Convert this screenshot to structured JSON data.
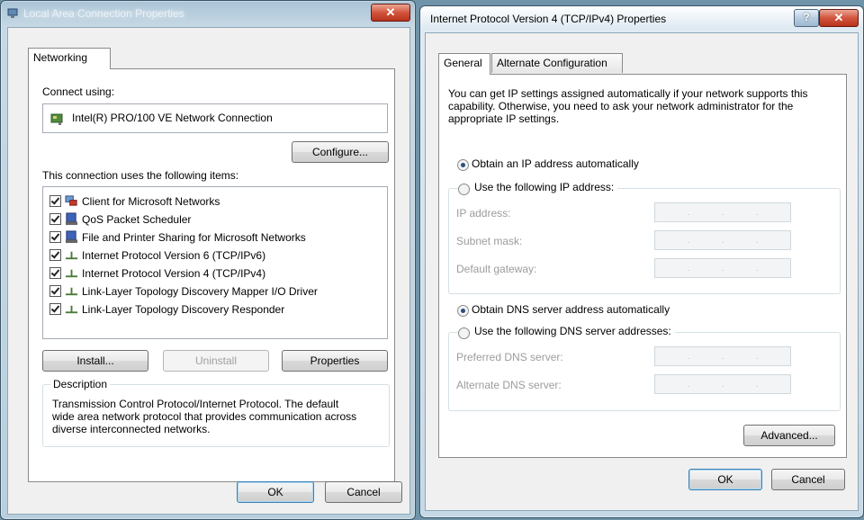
{
  "left_window": {
    "title": "Local Area Connection Properties",
    "tab": "Networking",
    "connect_using_label": "Connect using:",
    "adapter": "Intel(R) PRO/100 VE Network Connection",
    "configure_button": "Configure...",
    "items_label": "This connection uses the following items:",
    "items": [
      {
        "label": "Client for Microsoft Networks",
        "checked": true,
        "icon": "network-client-icon"
      },
      {
        "label": "QoS Packet Scheduler",
        "checked": true,
        "icon": "service-icon"
      },
      {
        "label": "File and Printer Sharing for Microsoft Networks",
        "checked": true,
        "icon": "service-icon"
      },
      {
        "label": "Internet Protocol Version 6 (TCP/IPv6)",
        "checked": true,
        "icon": "protocol-icon"
      },
      {
        "label": "Internet Protocol Version 4 (TCP/IPv4)",
        "checked": true,
        "icon": "protocol-icon"
      },
      {
        "label": "Link-Layer Topology Discovery Mapper I/O Driver",
        "checked": true,
        "icon": "protocol-icon"
      },
      {
        "label": "Link-Layer Topology Discovery Responder",
        "checked": true,
        "icon": "protocol-icon"
      }
    ],
    "install_button": "Install...",
    "uninstall_button": "Uninstall",
    "properties_button": "Properties",
    "description_label": "Description",
    "description_text": "Transmission Control Protocol/Internet Protocol. The default wide area network protocol that provides communication across diverse interconnected networks.",
    "ok_button": "OK",
    "cancel_button": "Cancel"
  },
  "right_window": {
    "title": "Internet Protocol Version 4 (TCP/IPv4) Properties",
    "help_button": "?",
    "tabs": [
      "General",
      "Alternate Configuration"
    ],
    "intro_text": "You can get IP settings assigned automatically if your network supports this capability. Otherwise, you need to ask your network administrator for the appropriate IP settings.",
    "obtain_ip_auto": "Obtain an IP address automatically",
    "use_following_ip": "Use the following IP address:",
    "ip_address_label": "IP address:",
    "subnet_mask_label": "Subnet mask:",
    "default_gateway_label": "Default gateway:",
    "obtain_dns_auto": "Obtain DNS server address automatically",
    "use_following_dns": "Use the following DNS server addresses:",
    "preferred_dns_label": "Preferred DNS server:",
    "alternate_dns_label": "Alternate DNS server:",
    "advanced_button": "Advanced...",
    "ok_button": "OK",
    "cancel_button": "Cancel",
    "ip_auto_selected": true,
    "dns_auto_selected": true
  },
  "colors": {
    "desktop": "#6f93a8",
    "close_red": "#c8432a",
    "window_frame": "#b9cfdd",
    "dialog_face": "#f0f0f0"
  }
}
